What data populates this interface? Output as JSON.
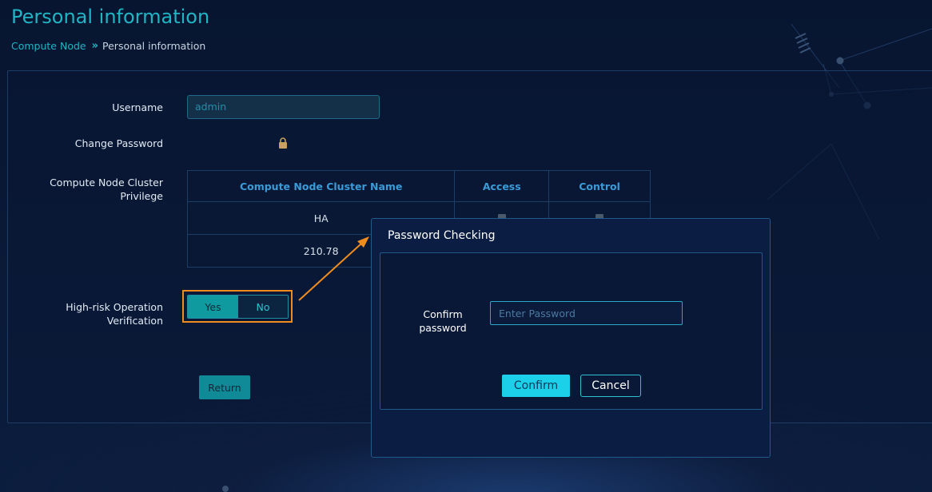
{
  "page": {
    "title": "Personal information"
  },
  "breadcrumb": {
    "parent": "Compute Node",
    "separator": "»",
    "current": "Personal information"
  },
  "form": {
    "username_label": "Username",
    "username_value": "admin",
    "change_password_label": "Change Password",
    "cluster_privilege_label": "Compute Node Cluster Privilege",
    "high_risk_label": "High-risk Operation Verification",
    "toggle": {
      "yes": "Yes",
      "no": "No",
      "selected": "Yes"
    },
    "return_label": "Return"
  },
  "cluster_table": {
    "headers": [
      "Compute Node Cluster Name",
      "Access",
      "Control"
    ],
    "rows": [
      {
        "name": "HA"
      },
      {
        "name": "210.78"
      }
    ]
  },
  "dialog": {
    "title": "Password Checking",
    "confirm_password_label": "Confirm password",
    "password_placeholder": "Enter Password",
    "confirm_label": "Confirm",
    "cancel_label": "Cancel"
  },
  "colors": {
    "accent": "#1fb5c4",
    "highlight": "#f08c1e",
    "header_link": "#3a9bd8"
  }
}
